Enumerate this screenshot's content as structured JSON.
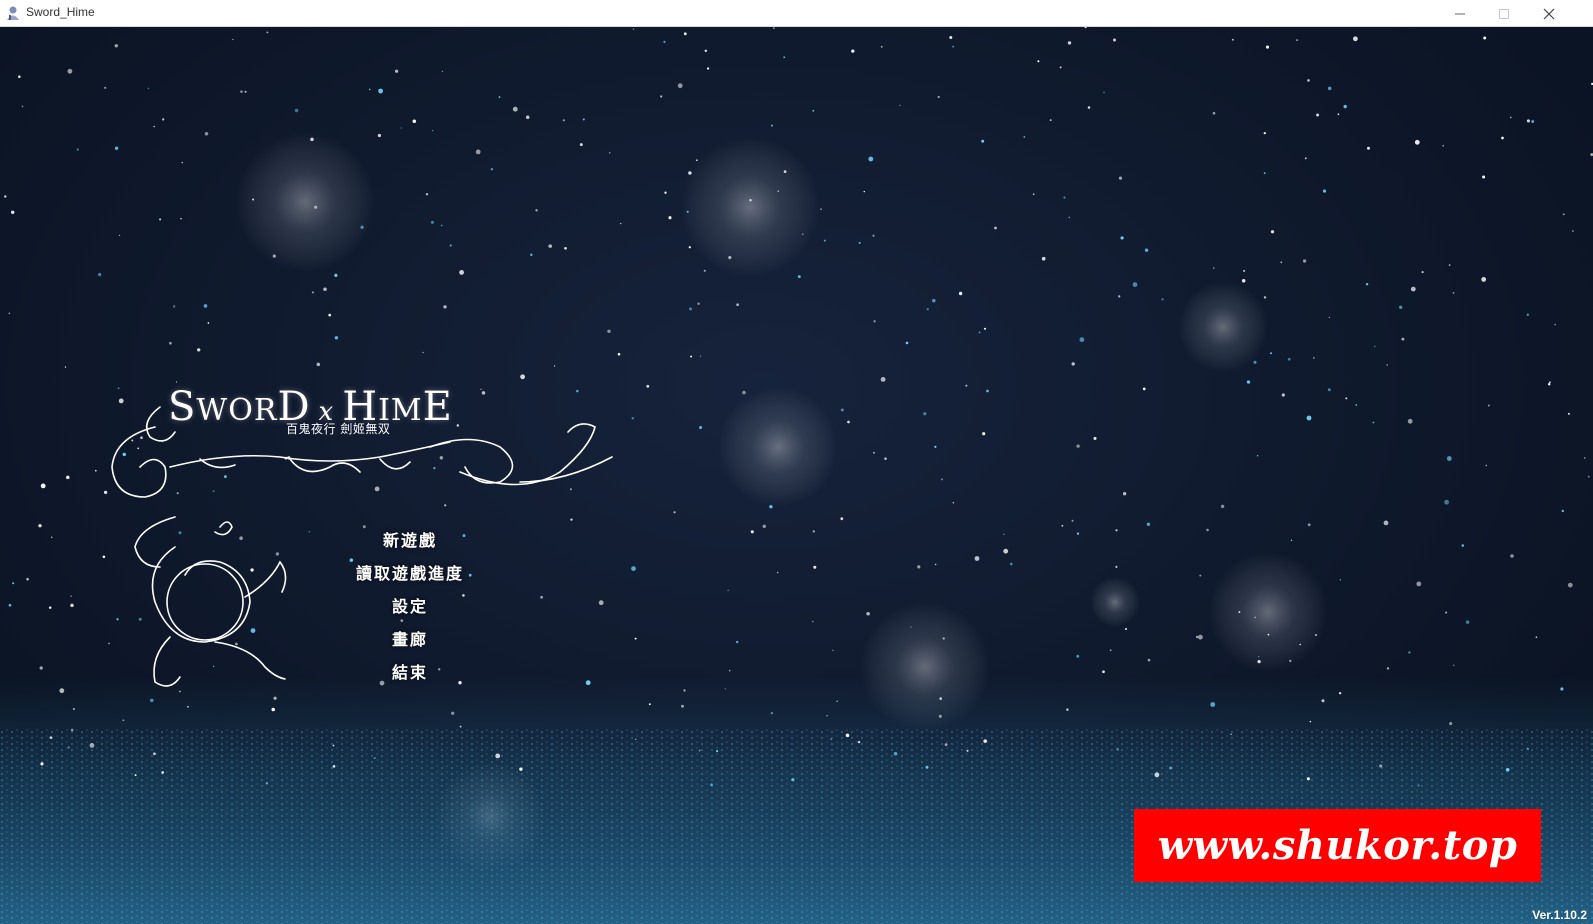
{
  "window": {
    "title": "Sword_Hime",
    "icon": "app-icon",
    "controls": [
      "minimize-icon",
      "maximize-icon",
      "close-icon"
    ]
  },
  "logo": {
    "title_parts": [
      "S",
      "WOR",
      "D",
      "x",
      "H",
      "IM",
      "E"
    ],
    "subtitle": "百鬼夜行 劍姬無双"
  },
  "menu": {
    "items": [
      {
        "label": "新遊戲"
      },
      {
        "label": "讀取遊戲進度"
      },
      {
        "label": "設定"
      },
      {
        "label": "畫廊"
      },
      {
        "label": "結束"
      }
    ]
  },
  "watermark": {
    "text": "www.shukor.top",
    "color": "#ff0000"
  },
  "version": "Ver.1.10.2"
}
